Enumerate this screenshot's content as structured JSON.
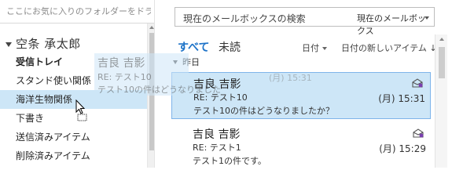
{
  "colors": {
    "accent": "#1e73c8",
    "selection": "#cde6f7",
    "selection_border": "#7eb4ea"
  },
  "folder_pane": {
    "favorites_hint": "ここにお気に入りのフォルダーをドラッ",
    "account_name": "空条 承太郎",
    "folders": [
      {
        "label": "受信トレイ",
        "bold": true
      },
      {
        "label": "スタンド使い関係"
      },
      {
        "label": "海洋生物関係",
        "hover": true
      },
      {
        "label": "下書き"
      },
      {
        "label": "送信済みアイテム"
      },
      {
        "label": "削除済みアイテム"
      }
    ]
  },
  "drag_ghost": {
    "name": "吉良 吉影",
    "subject": "RE: テスト10",
    "preview": "テスト10の件はどうなりました",
    "trail": "(月) 15:31"
  },
  "search": {
    "placeholder": "現在のメールボックスの検索",
    "scope": "現在のメールボックス",
    "icon": "search-icon"
  },
  "filters": {
    "all": "すべて",
    "unread": "未読",
    "sort_by": "日付",
    "sort_order": "日付の新しいアイテム ↓"
  },
  "group": {
    "label": "昨日"
  },
  "messages": [
    {
      "from": "吉良 吉影",
      "subject": "RE: テスト10",
      "preview": "テスト10の件はどうなりましたか？",
      "time": "(月) 15:31",
      "icon": "meeting-request-icon",
      "selected": true
    },
    {
      "from": "吉良 吉影",
      "subject": "RE: テスト1",
      "preview": "テスト1の件です。",
      "time": "(月) 15:29",
      "icon": "meeting-request-icon",
      "selected": false
    }
  ]
}
